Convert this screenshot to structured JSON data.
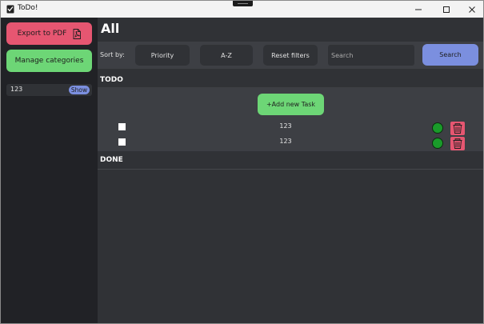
{
  "window": {
    "title": "ToDo!"
  },
  "sidebar": {
    "export_label": "Export to PDF",
    "manage_label": "Manage categories",
    "categories": [
      {
        "label": "123",
        "action": "Show"
      }
    ]
  },
  "main": {
    "heading": "All",
    "sort_label": "Sort by:",
    "sort_buttons": {
      "priority": "Priority",
      "az": "A-Z",
      "reset": "Reset filters"
    },
    "search": {
      "placeholder": "Search",
      "button": "Search"
    },
    "todo": {
      "title": "TODO",
      "add_label": "+Add new Task",
      "tasks": [
        {
          "text": "123",
          "done": false
        },
        {
          "text": "123",
          "done": false
        }
      ]
    },
    "done": {
      "title": "DONE",
      "tasks": []
    }
  },
  "colors": {
    "pink": "#e65671",
    "green": "#6dd676",
    "blue": "#7b8fdf",
    "bg": "#303236",
    "sidebar": "#212226"
  },
  "icons": {
    "export": "pdf-icon",
    "delete": "trash-icon",
    "status": "circle-icon"
  }
}
